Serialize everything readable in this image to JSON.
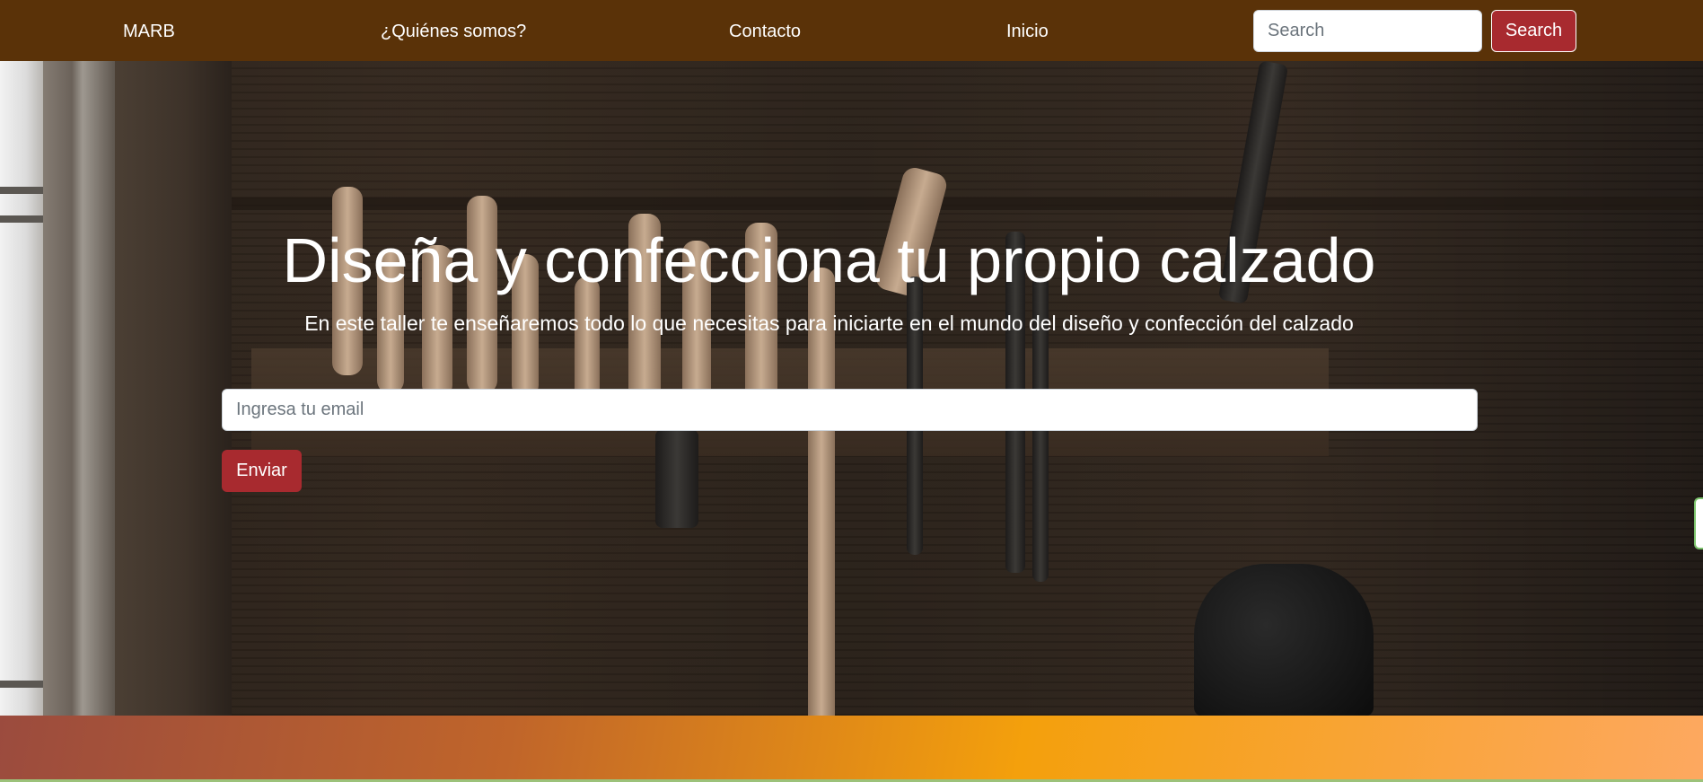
{
  "navbar": {
    "brand": "MARB",
    "links": [
      "¿Quiénes somos?",
      "Contacto",
      "Inicio"
    ],
    "search_placeholder": "Search",
    "search_button": "Search"
  },
  "hero": {
    "title": "Diseña y confecciona tu propio calzado",
    "subtitle": "En este taller te enseñaremos todo lo que necesitas para iniciarte en el mundo del diseño y confección del calzado",
    "email_placeholder": "Ingresa tu email",
    "submit_button": "Enviar"
  },
  "colors": {
    "navbar_bg": "#5a3208",
    "button_bg": "#a82a2f",
    "gradient_start": "#9b4b3e",
    "gradient_mid": "#f4a00c",
    "gradient_end": "#fda860"
  }
}
